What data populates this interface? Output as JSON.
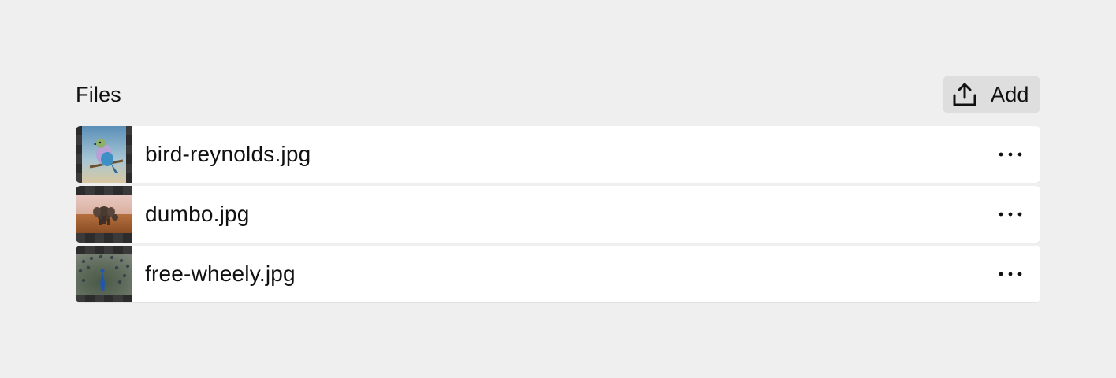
{
  "header": {
    "title": "Files",
    "add_label": "Add",
    "add_icon": "upload-icon"
  },
  "files": [
    {
      "name": "bird-reynolds.jpg",
      "thumbnail": "bird-thumbnail"
    },
    {
      "name": "dumbo.jpg",
      "thumbnail": "elephant-thumbnail"
    },
    {
      "name": "free-wheely.jpg",
      "thumbnail": "peacock-thumbnail"
    }
  ],
  "row_menu_icon": "more-horizontal-icon"
}
